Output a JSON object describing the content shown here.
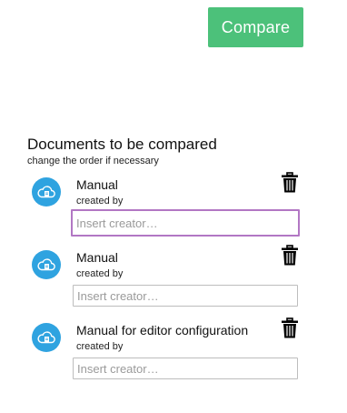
{
  "toolbar": {
    "compare_label": "Compare"
  },
  "colors": {
    "compare_button": "#4cc17a",
    "cloud_icon": "#2fa3e0",
    "focus_border": "#b277c4"
  },
  "documents_section": {
    "title": "Documents to be compared",
    "subtitle": "change the order if necessary",
    "documents": [
      {
        "name": "Manual",
        "created_by_label": "created by",
        "creator_value": "",
        "creator_placeholder": "Insert creator…",
        "icon": "cloud-document-icon",
        "delete_icon": "trash-icon"
      },
      {
        "name": "Manual",
        "created_by_label": "created by",
        "creator_value": "",
        "creator_placeholder": "Insert creator…",
        "icon": "cloud-document-icon",
        "delete_icon": "trash-icon"
      },
      {
        "name": "Manual for editor configuration",
        "created_by_label": "created by",
        "creator_value": "",
        "creator_placeholder": "Insert creator…",
        "icon": "cloud-document-icon",
        "delete_icon": "trash-icon"
      }
    ]
  }
}
